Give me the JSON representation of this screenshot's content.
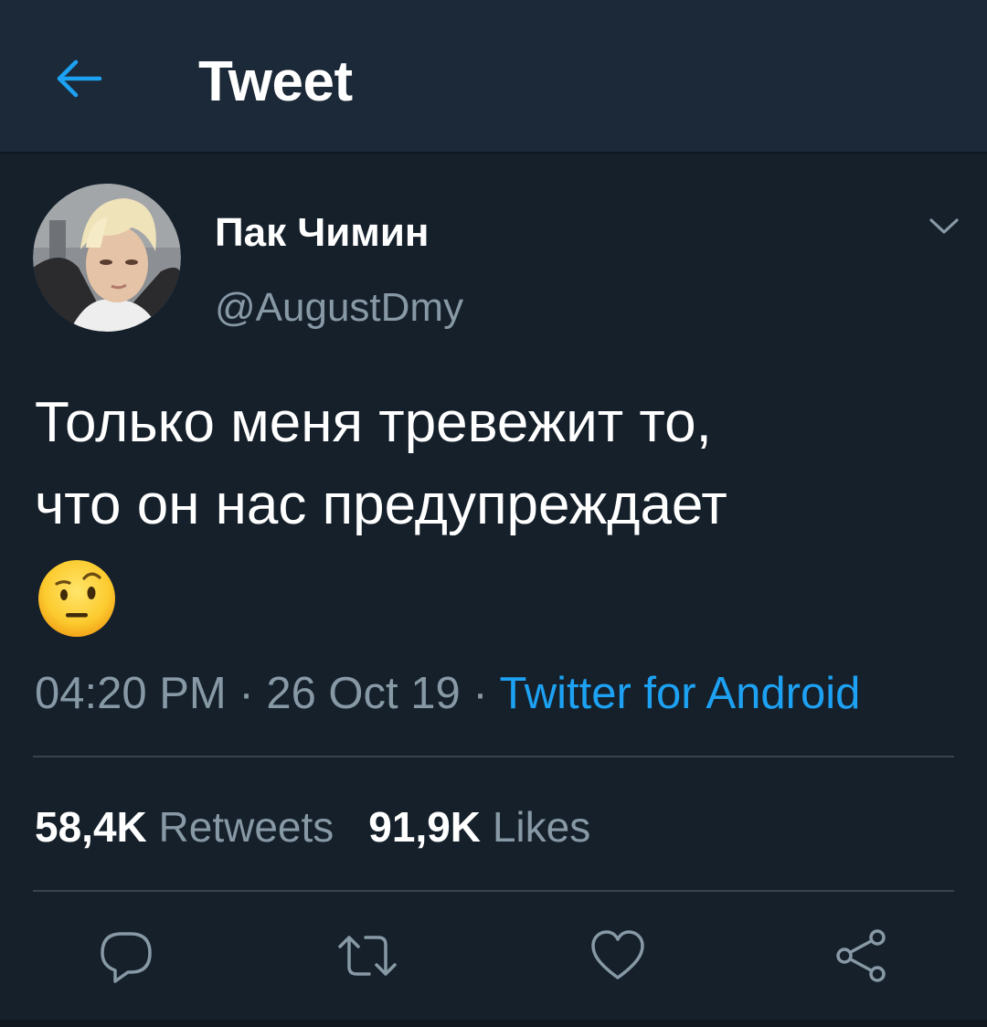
{
  "header": {
    "title": "Tweet",
    "back_icon": "arrow-left-icon"
  },
  "tweet": {
    "author": {
      "display_name": "Пак Чимин",
      "handle": "@AugustDmy"
    },
    "text_lines": [
      "Только меня тревежит то,",
      "что он нас предупреждает"
    ],
    "emoji": "face-with-raised-eyebrow",
    "time": "04:20 PM",
    "date": "26 Oct 19",
    "separator": "·",
    "source": "Twitter for Android",
    "stats": {
      "retweets_count": "58,4K",
      "retweets_label": "Retweets",
      "likes_count": "91,9K",
      "likes_label": "Likes"
    },
    "actions": [
      "reply-icon",
      "retweet-icon",
      "like-icon",
      "share-icon"
    ]
  },
  "colors": {
    "background": "#15202b",
    "header_background": "#1c2938",
    "accent": "#1da1f2",
    "secondary_text": "#8899a6",
    "divider": "#38444d"
  }
}
